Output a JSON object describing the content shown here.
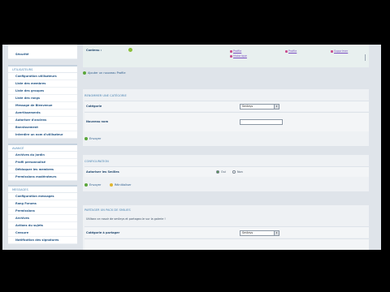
{
  "sidebar": {
    "top_item": "Sécurité",
    "groups": [
      {
        "title": "UTILISATEURS",
        "items": [
          "Configuration utilisateurs",
          "Liste des membres",
          "Liste des groupes",
          "Liste des rangs",
          "Message de Bienvenue",
          "Avertissements",
          "Autoriser d'anciens",
          "Bannissement",
          "Interdire un nom d'utilisateur"
        ]
      },
      {
        "title": "AVANCÉ",
        "items": [
          "Archives du jardin",
          "Profil personnalisé",
          "Débloquer les membres",
          "Permissions modérateurs"
        ]
      },
      {
        "title": "MESSAGES",
        "items": [
          "Configuration messages",
          "Rang Forums",
          "Permissions",
          "Archives",
          "Actions du sujets",
          "Censure",
          "Notification des signatures"
        ]
      }
    ]
  },
  "top_panel": {
    "label": "Contenu :",
    "links": [
      "Profile",
      "Historique",
      "Profile",
      "Supprimer"
    ],
    "add_link": "Ajouter un nouveau Profile"
  },
  "rename_section": {
    "title": "RENOMMER UNE CATÉGORIE",
    "category_label": "Catégorie",
    "category_value": "Smileys",
    "new_name_label": "Nouveau nom",
    "new_name_value": "",
    "submit": "Envoyer"
  },
  "config_section": {
    "title": "CONFIGURATION",
    "label": "Autoriser les Smilies",
    "yes": "Oui",
    "no": "Non",
    "yes_selected": true,
    "submit": "Envoyer",
    "reset": "Réinitialiser"
  },
  "share_section": {
    "title": "PARTAGER UN PACK DE SMILIES",
    "description": "Utilisez ce rasoir de smileys et partagez-le sur la galerie !",
    "category_label": "Catégorie à partager",
    "category_value": "Smileys"
  },
  "colors": {
    "accent": "#4c86b4",
    "link": "#2a5b8a",
    "page_bg": "#dfe4ea"
  }
}
